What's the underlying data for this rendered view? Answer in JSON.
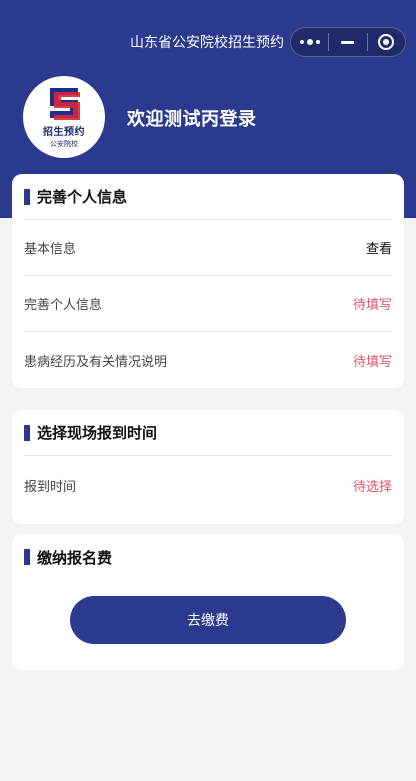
{
  "nav": {
    "title": "山东省公安院校招生预约"
  },
  "header": {
    "logo_text": "招生预约",
    "logo_subtext": "公安院校",
    "welcome": "欢迎测试丙登录"
  },
  "personal_info": {
    "title": "完善个人信息",
    "rows": [
      {
        "label": "基本信息",
        "status": "查看"
      },
      {
        "label": "完善个人信息",
        "status": "待填写"
      },
      {
        "label": "患病经历及有关情况说明",
        "status": "待填写"
      }
    ]
  },
  "report_time": {
    "title": "选择现场报到时间",
    "rows": [
      {
        "label": "报到时间",
        "status": "待选择"
      }
    ]
  },
  "fee": {
    "title": "缴纳报名费",
    "button": "去缴费"
  },
  "colors": {
    "brand": "#2b3a8f",
    "pending": "#e0526a",
    "background": "#f3f3f3"
  }
}
